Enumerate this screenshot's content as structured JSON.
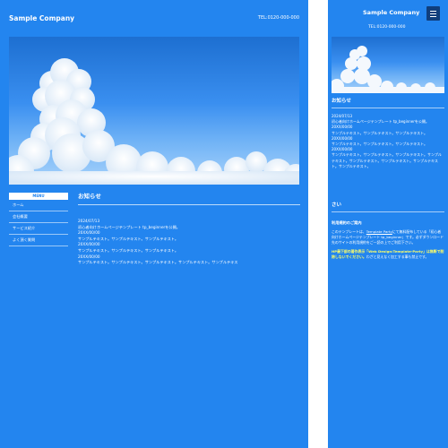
{
  "desktop": {
    "logo": "Sample Company",
    "tel": "TEL:0120-000-000",
    "nav": {
      "head": "MENU",
      "items": [
        "ホーム",
        "会社概要",
        "サービス紹介",
        "よく頂く質問"
      ]
    },
    "main": {
      "heading": "お知らせ",
      "news": [
        {
          "date": "2024/07/13",
          "text": "初心者向けホームページテンプレート tp_beginnerを公開。"
        },
        {
          "date": "20XX/00/00",
          "text": "サンプルテキスト。サンプルテキスト。サンプルテキスト。"
        },
        {
          "date": "20XX/00/00",
          "text": "サンプルテキスト。サンプルテキスト。サンプルテキスト。"
        },
        {
          "date": "20XX/00/00",
          "text": "サンプルテキスト。サンプルテキスト。サンプルテキスト。サンプルテキスト。サンプルテキス"
        }
      ]
    }
  },
  "mobile": {
    "logo": "Sample Company",
    "tel": "TEL:0120-000-000",
    "menu_icon": "hamburger-icon",
    "news_heading": "お知らせ",
    "news": [
      {
        "date": "2024/07/13",
        "text": "初心者向けホームページテンプレート tp_beginnerを公開。"
      },
      {
        "date": "20XX/00/00",
        "text": "サンプルテキスト。サンプルテキスト。サンプルテキスト。"
      },
      {
        "date": "20XX/00/00",
        "text": "サンプルテキスト。サンプルテキスト。サンプルテキスト。"
      },
      {
        "date": "20XX/00/00",
        "text": "サンプルテキスト。サンプルテキスト。サンプルテキスト。サンプルテキスト。サンプルテキスト。サンプルテキスト。サンプルテキスト。サンプルテキスト。"
      }
    ],
    "second_heading": "さい",
    "terms": {
      "title": "利用規約のご案内",
      "p1_before": "このテンプレートは、",
      "p1_link": "Template Party",
      "p1_after": "にて無料配布している「初心者向けホームページテンプレート tp_beginner」です。必ずダウンロード先のサイトの利用規約をご一読の上でご利用下さい。",
      "p2_warn": "HP最下部の著作表示「Web Design:Template-Party」は無断で削除しないでください。",
      "p2_after": "わざと見えなく加工する事も禁止です。"
    }
  },
  "colors": {
    "background": "#2385ef",
    "menu_button": "#103e7c",
    "warning": "#ffff66"
  }
}
